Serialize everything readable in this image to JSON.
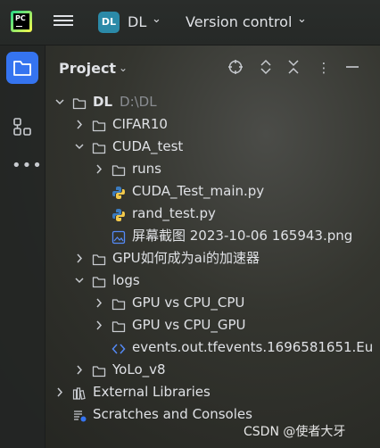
{
  "topbar": {
    "logo": "pycharm-logo",
    "project_badge": "DL",
    "project_name": "DL",
    "version_control": "Version control"
  },
  "panel": {
    "title": "Project"
  },
  "tree": [
    {
      "label": "DL",
      "path": "D:\\DL",
      "level": 0,
      "expanded": true,
      "icon": "folder-icon",
      "bold": true
    },
    {
      "label": "CIFAR10",
      "level": 1,
      "expanded": false,
      "icon": "folder-icon"
    },
    {
      "label": "CUDA_test",
      "level": 1,
      "expanded": true,
      "icon": "folder-icon"
    },
    {
      "label": "runs",
      "level": 2,
      "expanded": false,
      "icon": "folder-icon"
    },
    {
      "label": "CUDA_Test_main.py",
      "level": 2,
      "expanded": null,
      "icon": "python-file-icon"
    },
    {
      "label": "rand_test.py",
      "level": 2,
      "expanded": null,
      "icon": "python-file-icon"
    },
    {
      "label": "屏幕截图 2023-10-06 165943.png",
      "level": 2,
      "expanded": null,
      "icon": "image-file-icon"
    },
    {
      "label": "GPU如何成为ai的加速器",
      "level": 1,
      "expanded": false,
      "icon": "folder-icon"
    },
    {
      "label": "logs",
      "level": 1,
      "expanded": true,
      "icon": "folder-icon"
    },
    {
      "label": "GPU vs CPU_CPU",
      "level": 2,
      "expanded": false,
      "icon": "folder-icon"
    },
    {
      "label": "GPU vs CPU_GPU",
      "level": 2,
      "expanded": false,
      "icon": "folder-icon"
    },
    {
      "label": "events.out.tfevents.1696581651.Eu",
      "level": 2,
      "expanded": null,
      "icon": "code-file-icon"
    },
    {
      "label": "YoLo_v8",
      "level": 1,
      "expanded": false,
      "icon": "folder-icon"
    },
    {
      "label": "External Libraries",
      "level": 0,
      "expanded": false,
      "icon": "library-icon"
    },
    {
      "label": "Scratches and Consoles",
      "level": 0,
      "expanded": null,
      "icon": "scratches-icon"
    }
  ],
  "watermark": "CSDN @使者大牙"
}
